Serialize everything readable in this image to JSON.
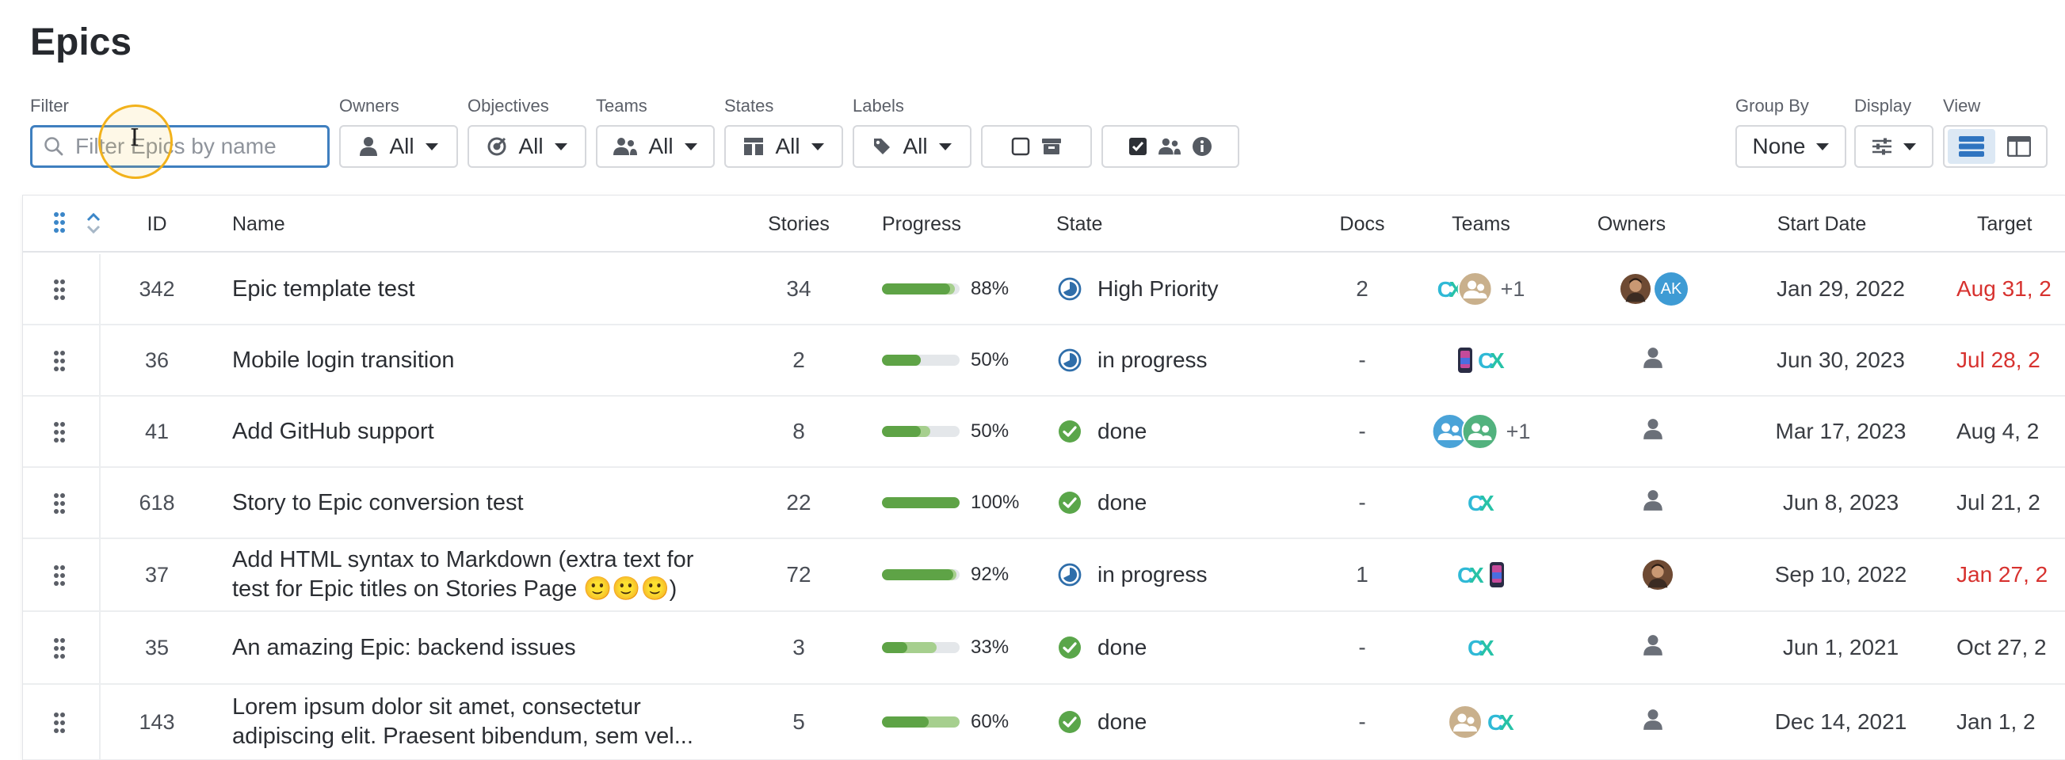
{
  "page": {
    "title": "Epics"
  },
  "filters": {
    "filter_label": "Filter",
    "search_placeholder": "Filter Epics by name",
    "owners": {
      "label": "Owners",
      "value": "All"
    },
    "objectives": {
      "label": "Objectives",
      "value": "All"
    },
    "teams": {
      "label": "Teams",
      "value": "All"
    },
    "states": {
      "label": "States",
      "value": "All"
    },
    "labels": {
      "label": "Labels",
      "value": "All"
    },
    "group_by": {
      "label": "Group By",
      "value": "None"
    },
    "display": {
      "label": "Display"
    },
    "view": {
      "label": "View"
    }
  },
  "table": {
    "headers": {
      "id": "ID",
      "name": "Name",
      "stories": "Stories",
      "progress": "Progress",
      "state": "State",
      "docs": "Docs",
      "teams": "Teams",
      "owners": "Owners",
      "start": "Start Date",
      "target": "Target"
    },
    "rows": [
      {
        "id": "342",
        "name": "Epic template test",
        "stories": "34",
        "progress_done": 0.88,
        "progress_started": 0.94,
        "pct": "88%",
        "state": "High Priority",
        "state_kind": "in-progress",
        "docs": "2",
        "teams_extra": "+1",
        "owner_initials": "AK",
        "start": "Jan 29, 2022",
        "target": "Aug 31, 2",
        "target_overdue": true
      },
      {
        "id": "36",
        "name": "Mobile login transition",
        "stories": "2",
        "progress_done": 0.5,
        "progress_started": 0.5,
        "pct": "50%",
        "state": "in progress",
        "state_kind": "in-progress",
        "docs": "-",
        "start": "Jun 30, 2023",
        "target": "Jul 28, 2",
        "target_overdue": true
      },
      {
        "id": "41",
        "name": "Add GitHub support",
        "stories": "8",
        "progress_done": 0.5,
        "progress_started": 0.62,
        "pct": "50%",
        "state": "done",
        "state_kind": "done",
        "docs": "-",
        "teams_extra": "+1",
        "start": "Mar 17, 2023",
        "target": "Aug 4, 2",
        "target_overdue": false
      },
      {
        "id": "618",
        "name": "Story to Epic conversion test",
        "stories": "22",
        "progress_done": 1.0,
        "progress_started": 1.0,
        "pct": "100%",
        "state": "done",
        "state_kind": "done",
        "docs": "-",
        "start": "Jun 8, 2023",
        "target": "Jul 21, 2",
        "target_overdue": false
      },
      {
        "id": "37",
        "name": "Add HTML syntax to Markdown (extra text for test for Epic titles on Stories Page 🙂🙂🙂)",
        "stories": "72",
        "progress_done": 0.92,
        "progress_started": 0.96,
        "pct": "92%",
        "state": "in progress",
        "state_kind": "in-progress",
        "docs": "1",
        "start": "Sep 10, 2022",
        "target": "Jan 27, 2",
        "target_overdue": true
      },
      {
        "id": "35",
        "name": "An amazing Epic: backend issues",
        "stories": "3",
        "progress_done": 0.33,
        "progress_started": 0.7,
        "pct": "33%",
        "state": "done",
        "state_kind": "done",
        "docs": "-",
        "start": "Jun 1, 2021",
        "target": "Oct 27, 2",
        "target_overdue": false
      },
      {
        "id": "143",
        "name": "Lorem ipsum dolor sit amet, consectetur adipiscing elit. Praesent bibendum, sem vel...",
        "stories": "5",
        "progress_done": 0.6,
        "progress_started": 1.0,
        "pct": "60%",
        "state": "done",
        "state_kind": "done",
        "docs": "-",
        "start": "Dec 14, 2021",
        "target": "Jan 1, 2",
        "target_overdue": false
      }
    ]
  },
  "colors": {
    "accent": "#3f7fbf",
    "progress_dark": "#5ea346",
    "progress_light": "#a6cf8e",
    "overdue": "#d7322f",
    "state_in_progress": "#2f6eaa",
    "state_done": "#5aa64a"
  }
}
